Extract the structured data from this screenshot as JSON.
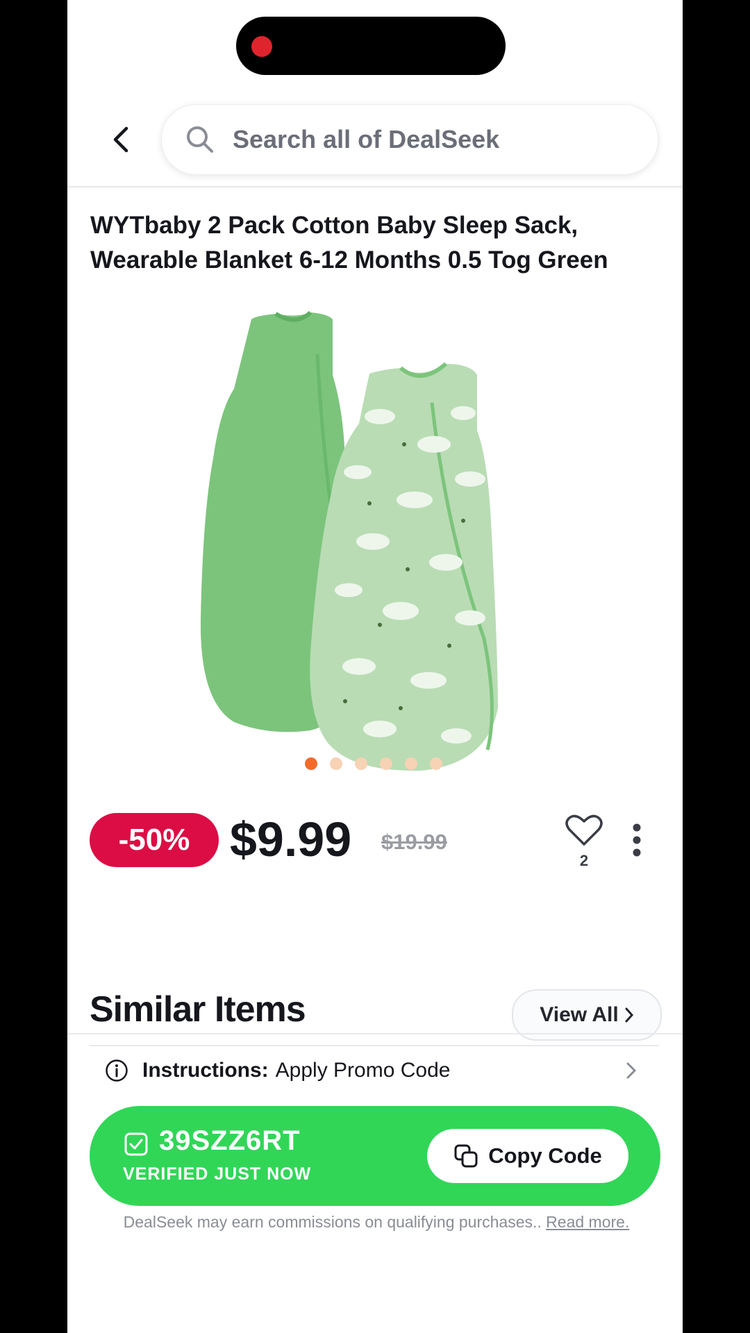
{
  "search": {
    "placeholder": "Search all of DealSeek"
  },
  "product": {
    "title": "WYTbaby 2 Pack Cotton Baby Sleep Sack, Wearable Blanket 6-12 Months 0.5 Tog Green",
    "image_index": 1,
    "image_count": 6,
    "discount": "-50%",
    "price": "$9.99",
    "original_price": "$19.99",
    "likes": "2"
  },
  "similar": {
    "heading": "Similar Items",
    "view_all": "View All"
  },
  "instructions": {
    "label": "Instructions:",
    "value": "Apply Promo Code"
  },
  "promo": {
    "code": "39SZZ6RT",
    "verified": "VERIFIED JUST NOW",
    "copy_label": "Copy Code",
    "color": "#31d657"
  },
  "disclaimer": {
    "text": "DealSeek may earn commissions on qualifying purchases.. ",
    "link": "Read more."
  },
  "colors": {
    "discount_badge": "#dc0d45",
    "active_dot": "#f26b2b",
    "inactive_dot": "#f7d2b5"
  }
}
